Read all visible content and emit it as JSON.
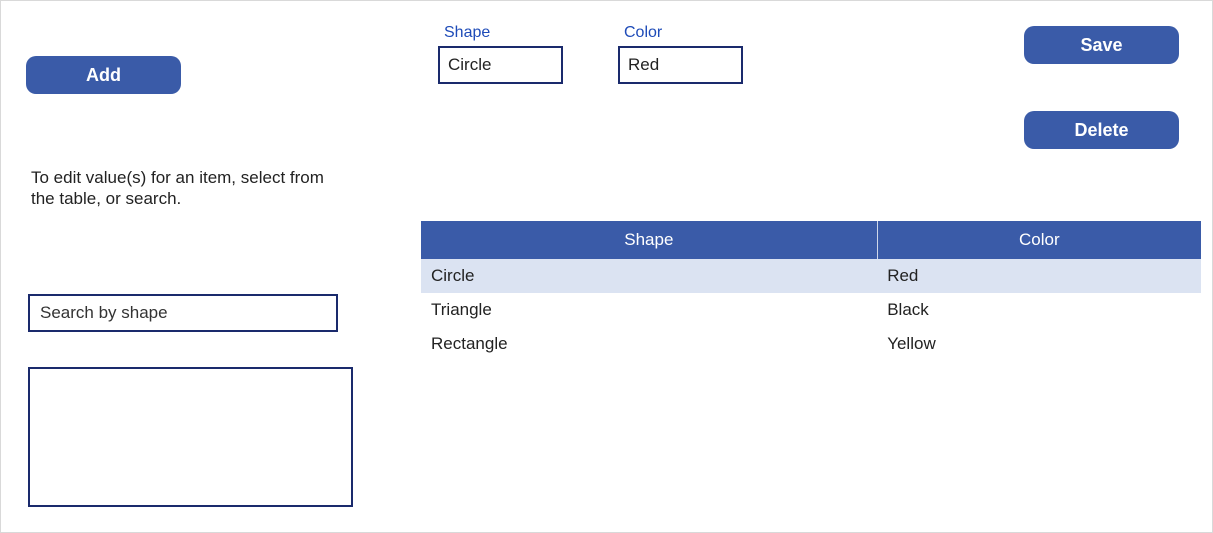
{
  "buttons": {
    "add": "Add",
    "save": "Save",
    "delete": "Delete"
  },
  "fields": {
    "shape": {
      "label": "Shape",
      "value": "Circle"
    },
    "color": {
      "label": "Color",
      "value": "Red"
    }
  },
  "help_text": "To edit value(s) for an item, select from the table, or search.",
  "search": {
    "placeholder": "Search by shape"
  },
  "table": {
    "headers": [
      "Shape",
      "Color"
    ],
    "rows": [
      {
        "shape": "Circle",
        "color": "Red",
        "selected": true
      },
      {
        "shape": "Triangle",
        "color": "Black",
        "selected": false
      },
      {
        "shape": "Rectangle",
        "color": "Yellow",
        "selected": false
      }
    ]
  },
  "colors": {
    "primary": "#3a5ba8",
    "border_dark": "#1a2a6c",
    "row_selected": "#dbe3f2"
  }
}
